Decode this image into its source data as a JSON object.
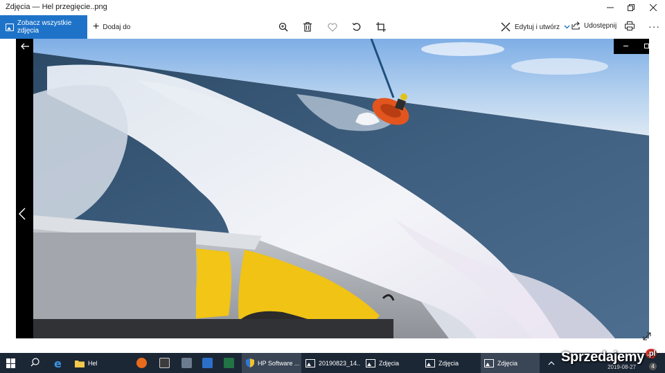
{
  "window": {
    "title": "Zdjęcia — Hel przegięcie..png"
  },
  "toolbar": {
    "see_all_label": "Zobacz wszystkie zdjęcia",
    "add_to_label": "Dodaj do",
    "edit_create_label": "Edytuj i utwórz",
    "share_label": "Udostępnij",
    "more_label": "···",
    "icons": [
      "zoom-icon",
      "delete-icon",
      "favorite-icon",
      "rotate-icon",
      "crop-icon",
      "print-icon"
    ]
  },
  "taskbar": {
    "apps": [
      {
        "label": "Hel",
        "icon": "folder-icon"
      },
      {
        "label": "HP Software ...",
        "icon": "shield-icon"
      },
      {
        "label": "20190823_14...",
        "icon": "photos-icon"
      },
      {
        "label": "Zdjęcia",
        "icon": "photos-icon"
      },
      {
        "label": "Zdjęcia",
        "icon": "photos-icon"
      },
      {
        "label": "Zdjęcia",
        "icon": "photos-icon"
      }
    ],
    "date": "2019-08-27",
    "notification_count": "4"
  },
  "watermark": {
    "text": "Sprzedajemy",
    "suffix": ".pl"
  },
  "colors": {
    "accent": "#1e73c9",
    "taskbar": "#1c2736",
    "tube": "#e2551f",
    "seat": "#f2c516"
  }
}
